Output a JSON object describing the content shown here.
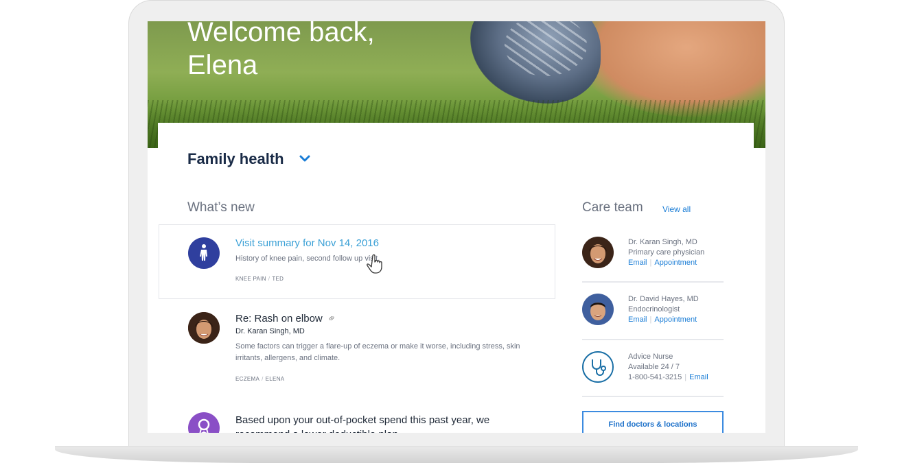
{
  "hero": {
    "title_line1": "Welcome back,",
    "title_line2": "Elena"
  },
  "section": {
    "title": "Family health",
    "toggle_icon": "chevron-down-icon"
  },
  "whats_new": {
    "title": "What’s new",
    "items": [
      {
        "icon": "person-body-icon",
        "icon_color": "#2f3f9e",
        "title": "Visit summary for Nov 14, 2016",
        "body": "History of knee pain, second follow up visit.",
        "tags": [
          "KNEE PAIN",
          "TED"
        ]
      },
      {
        "icon": "avatar",
        "title": "Re: Rash on elbow",
        "title_icon": "link-icon",
        "author": "Dr. Karan Singh, MD",
        "body": "Some factors can trigger a flare-up of eczema or make it worse, including stress, skin irritants, allergens, and climate.",
        "tags": [
          "ECZEMA",
          "ELENA"
        ]
      },
      {
        "icon": "badge-icon",
        "icon_color": "#8a4fc6",
        "title": "Based upon your out-of-pocket spend this past year, we recommend a lower deductible plan"
      }
    ]
  },
  "care_team": {
    "title": "Care team",
    "view_all": "View all",
    "members": [
      {
        "name": "Dr. Karan Singh, MD",
        "role": "Primary care physician",
        "email": "Email",
        "appointment": "Appointment"
      },
      {
        "name": "Dr. David Hayes, MD",
        "role": "Endocrinologist",
        "email": "Email",
        "appointment": "Appointment"
      },
      {
        "name": "Advice Nurse",
        "role": "Available 24 / 7",
        "phone": "1-800-541-3215",
        "email": "Email",
        "icon": "stethoscope-icon"
      }
    ],
    "find_button": "Find doctors & locations"
  },
  "colors": {
    "accent": "#3aa0d6",
    "link": "#1a7dd6",
    "navy": "#1a2b47",
    "button_border": "#3c8be0"
  }
}
